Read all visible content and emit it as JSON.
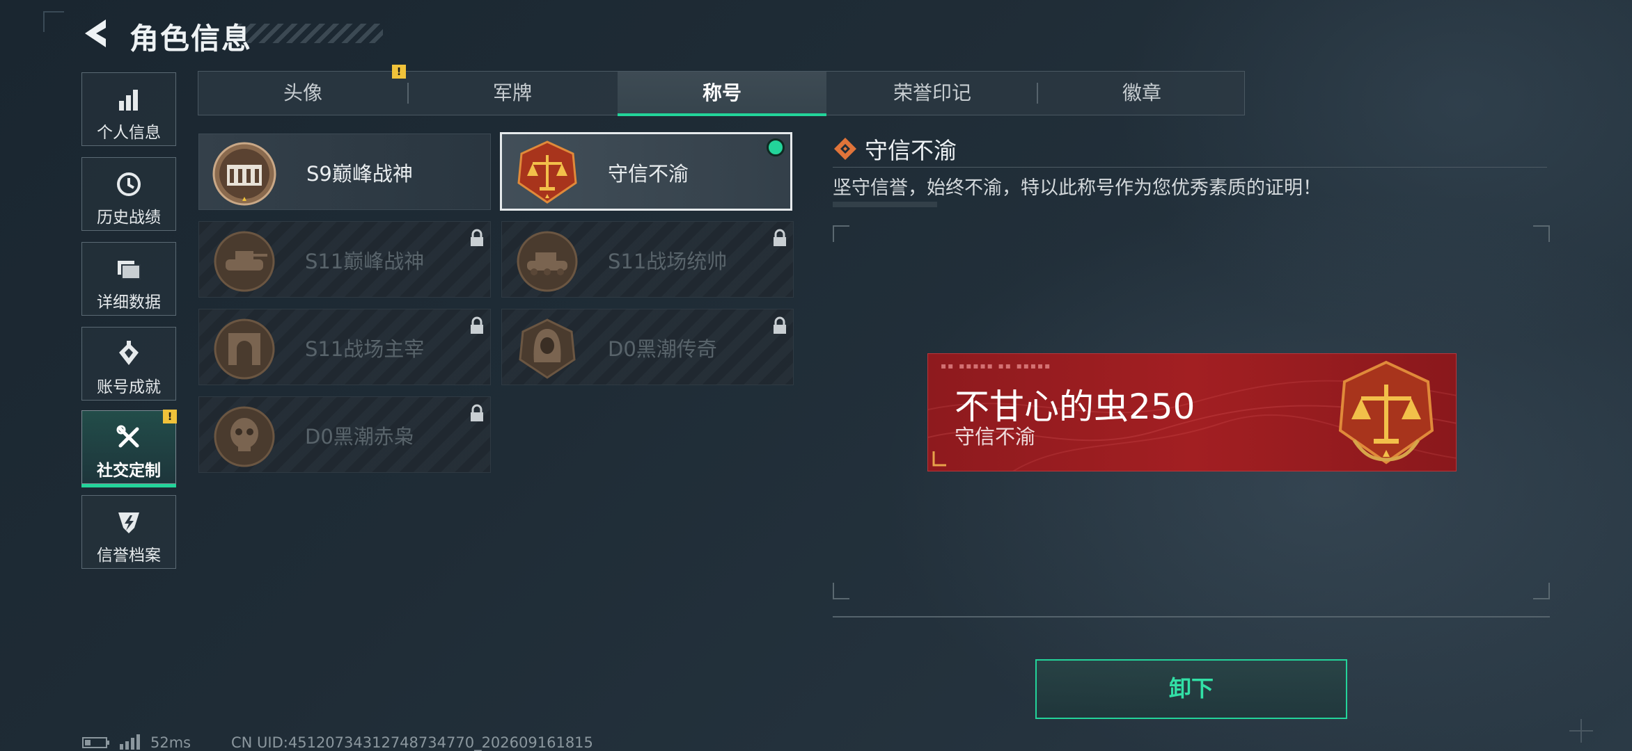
{
  "header": {
    "title": "角色信息"
  },
  "sidebar": {
    "items": [
      {
        "label": "个人信息",
        "icon": "bar-chart-icon"
      },
      {
        "label": "历史战绩",
        "icon": "clock-history-icon"
      },
      {
        "label": "详细数据",
        "icon": "folder-icon"
      },
      {
        "label": "账号成就",
        "icon": "achievement-icon"
      },
      {
        "label": "社交定制",
        "icon": "tools-icon",
        "active": true,
        "alert": "!"
      },
      {
        "label": "信誉档案",
        "icon": "credit-shield-icon"
      }
    ]
  },
  "tabs": [
    {
      "label": "头像",
      "alert": "!"
    },
    {
      "label": "军牌"
    },
    {
      "label": "称号",
      "active": true
    },
    {
      "label": "荣誉印记"
    },
    {
      "label": "徽章"
    }
  ],
  "titles": [
    {
      "name": "S9巅峰战神",
      "locked": false
    },
    {
      "name": "守信不渝",
      "locked": false,
      "selected": true,
      "equipped": true
    },
    {
      "name": "S11巅峰战神",
      "locked": true
    },
    {
      "name": "S11战场统帅",
      "locked": true
    },
    {
      "name": "S11战场主宰",
      "locked": true
    },
    {
      "name": "D0黑潮传奇",
      "locked": true
    },
    {
      "name": "D0黑潮赤枭",
      "locked": true
    }
  ],
  "detail": {
    "title": "守信不渝",
    "description": "坚守信誉，始终不渝，特以此称号作为您优秀素质的证明！"
  },
  "preview": {
    "player_name": "不甘心的虫250",
    "title": "守信不渝"
  },
  "actions": {
    "unequip": "卸下"
  },
  "status": {
    "ping": "52ms",
    "uid": "CN UID:45120734312748734770_202609161815"
  },
  "colors": {
    "accent": "#23d49a",
    "banner_red": "#a21f22",
    "warning": "#f0c23a"
  }
}
